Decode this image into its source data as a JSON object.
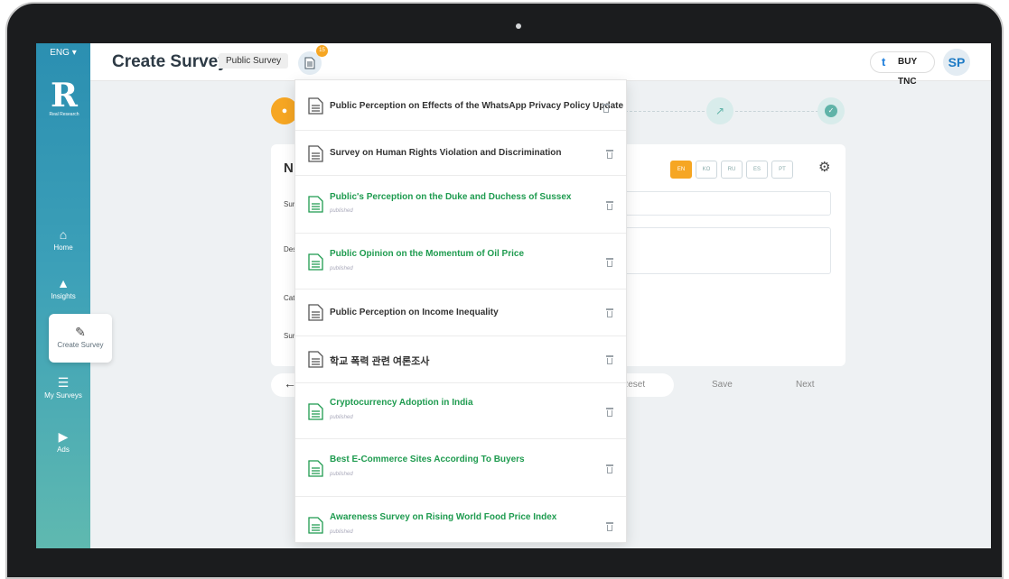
{
  "app": {
    "language": "ENG",
    "logo_text": "Real Research"
  },
  "sidebar": {
    "items": [
      {
        "label": "Home",
        "icon": "home-icon"
      },
      {
        "label": "Insights",
        "icon": "insights-icon"
      },
      {
        "label": "Create Survey",
        "icon": "pencil-icon",
        "active": true
      },
      {
        "label": "My Surveys",
        "icon": "list-icon"
      },
      {
        "label": "Ads",
        "icon": "play-icon"
      }
    ]
  },
  "header": {
    "title": "Create Survey",
    "survey_type": "Public Survey",
    "draft_count": "15",
    "buy_label": "BUY TNC",
    "avatar": "SP"
  },
  "form": {
    "heading": "N",
    "languages": [
      "EN",
      "KO",
      "RU",
      "ES",
      "PT"
    ],
    "active_language": "EN",
    "labels": [
      "Sur",
      "Des",
      "Cat",
      "Sur"
    ],
    "reset_label": "Reset",
    "save_label": "Save",
    "next_label": "Next"
  },
  "dropdown": {
    "items": [
      {
        "title": "Public Perception on Effects of the WhatsApp Privacy Policy Update",
        "status": "",
        "published": false
      },
      {
        "title": "Survey on Human Rights Violation and Discrimination",
        "status": "",
        "published": false
      },
      {
        "title": "Public's Perception on the Duke and Duchess of Sussex",
        "status": "published",
        "published": true
      },
      {
        "title": "Public Opinion on the Momentum of Oil Price",
        "status": "published",
        "published": true
      },
      {
        "title": "Public Perception on Income Inequality",
        "status": "",
        "published": false
      },
      {
        "title": "학교 폭력 관련 여론조사",
        "status": "",
        "published": false
      },
      {
        "title": "Cryptocurrency Adoption in India",
        "status": "published",
        "published": true
      },
      {
        "title": "Best E-Commerce Sites According To Buyers",
        "status": "published",
        "published": true
      },
      {
        "title": "Awareness Survey on Rising World Food Price Index",
        "status": "published",
        "published": true
      }
    ]
  },
  "colors": {
    "accent": "#f6a623",
    "published": "#1e9b4f",
    "sidebar_top": "#2b8fb1",
    "sidebar_bottom": "#5fb9b0"
  }
}
